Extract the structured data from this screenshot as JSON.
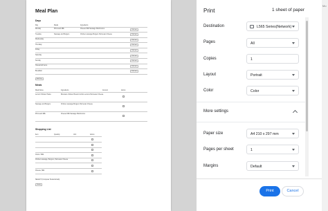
{
  "preview": {
    "title": "Meal Plan",
    "days_heading": "Days",
    "days_cols": [
      "Day",
      "Meals",
      "Ingredients"
    ],
    "days_rows": [
      {
        "day": "Monday",
        "meal": "Pizza and Milk",
        "ingredients": "Cheese    Milk    Sausage    Mushrooms",
        "btn": "Click me"
      },
      {
        "day": "Tuesday",
        "meal": "Sausage and Burgers",
        "ingredients": "Chicken sausage    Burgers    Parmesan Cheese",
        "btn": "Click me"
      },
      {
        "day": "Wednesday",
        "meal": "",
        "ingredients": "",
        "btn": "Click me"
      },
      {
        "day": "Thursday",
        "meal": "",
        "ingredients": "",
        "btn": "Click me"
      },
      {
        "day": "Friday",
        "meal": "",
        "ingredients": "",
        "btn": "Click me"
      },
      {
        "day": "Saturday",
        "meal": "",
        "ingredients": "",
        "btn": "Click me"
      },
      {
        "day": "Sunday",
        "meal": "",
        "ingredients": "",
        "btn": "Click me"
      },
      {
        "day": "Household Items",
        "meal": "",
        "ingredients": "",
        "btn": "Click me"
      },
      {
        "day": "Breakfast",
        "meal": "",
        "ingredients": "",
        "btn": "Click me"
      }
    ],
    "add_day_btn": "Add Day",
    "meals_heading": "Meals",
    "meals_cols": [
      "Meal Name",
      "Ingredients",
      "Amount",
      "Action"
    ],
    "meals_rows": [
      {
        "name": "Lemon Chicken Pasta",
        "ingredients": "Boneless chicken    Bread crumbs    Lemons    Parmesan Cheese"
      },
      {
        "name": "Sausage and Burgers",
        "ingredients": "Chicken sausage    Burgers    Parmesan Cheese"
      },
      {
        "name": "Pizza and Milk",
        "ingredients": "Cheese    Milk    Sausage    Mushrooms"
      }
    ],
    "shopping_heading": "Shopping List",
    "shopping_cols": [
      "Item",
      "Quantity",
      "Unit",
      "Action"
    ],
    "shopping_rows": [
      "",
      "",
      "",
      "Onion / Milk",
      "Chicken sausage, Burgers, Parmesan Cheese",
      "",
      "Cheese, Milk"
    ],
    "footer_text": "SELECT (Computer Students/Lab)",
    "footer_btn": "Ready"
  },
  "panel": {
    "title": "Print",
    "sheets": "1 sheet of paper",
    "side_text": "Mo",
    "rows": [
      {
        "label": "Destination",
        "value": "L565 Series(Network)"
      },
      {
        "label": "Pages",
        "value": "All"
      },
      {
        "label": "Copies",
        "value": "1"
      },
      {
        "label": "Layout",
        "value": "Portrait"
      },
      {
        "label": "Color",
        "value": "Color"
      },
      {
        "label": "More settings",
        "value": ""
      },
      {
        "label": "Paper size",
        "value": "A4 210 x 297 mm"
      },
      {
        "label": "Pages per sheet",
        "value": "1"
      },
      {
        "label": "Margins",
        "value": "Default"
      }
    ],
    "print_button": "Print",
    "cancel_button": "Cancel"
  },
  "colors": {
    "accent": "#1a73e8",
    "preview_bg": "#d4d4d4"
  }
}
